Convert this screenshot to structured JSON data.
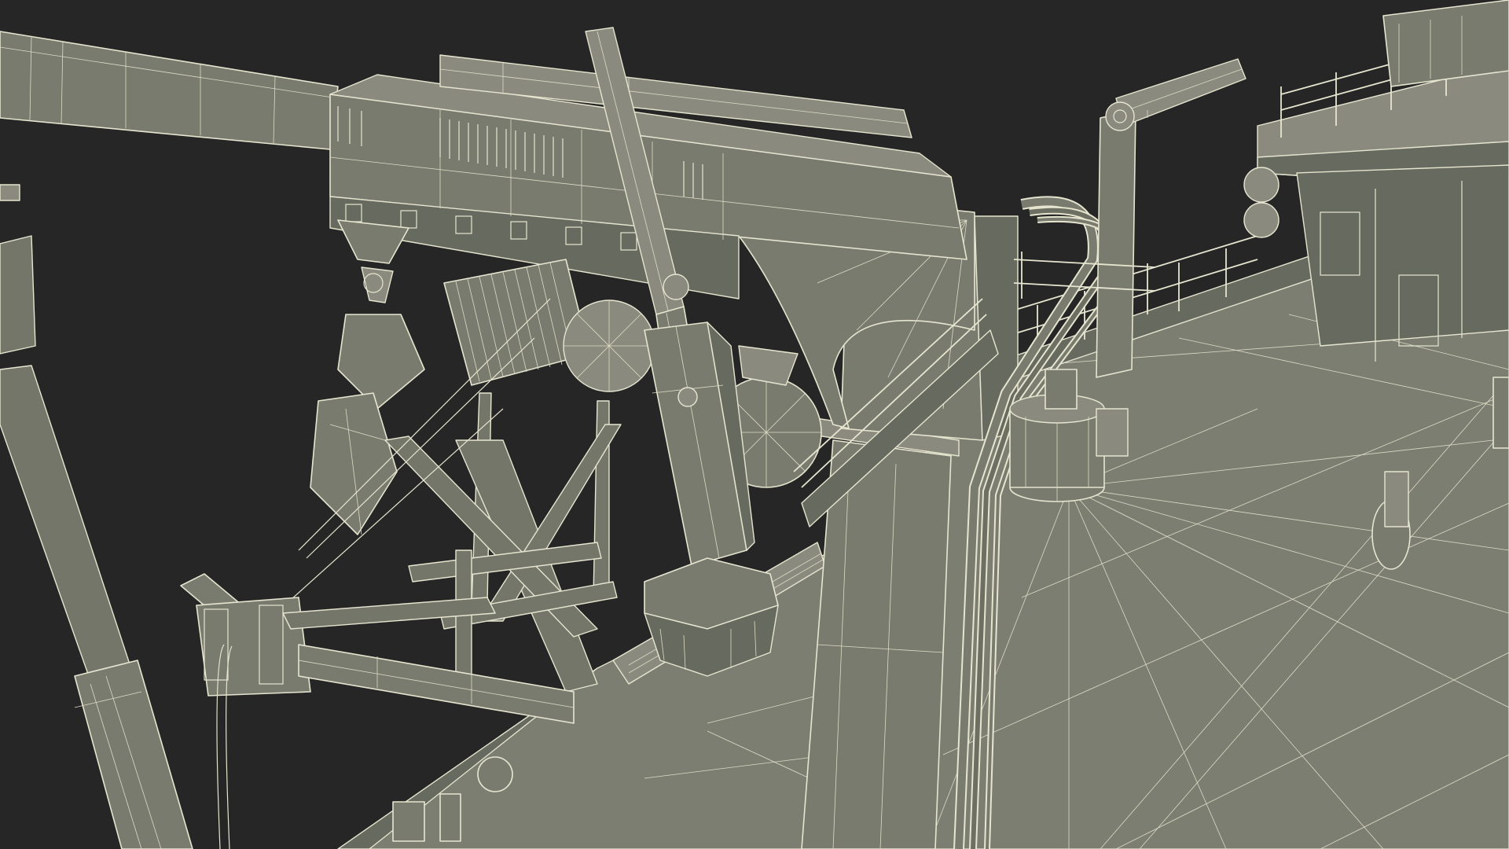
{
  "scene": {
    "subject": "ship-deck-crane-wireframe",
    "render_style": "wireframe-over-shaded",
    "colors": {
      "background": "#262626",
      "surface": "#7a7b6f",
      "wire": "#e6e5cf"
    }
  }
}
